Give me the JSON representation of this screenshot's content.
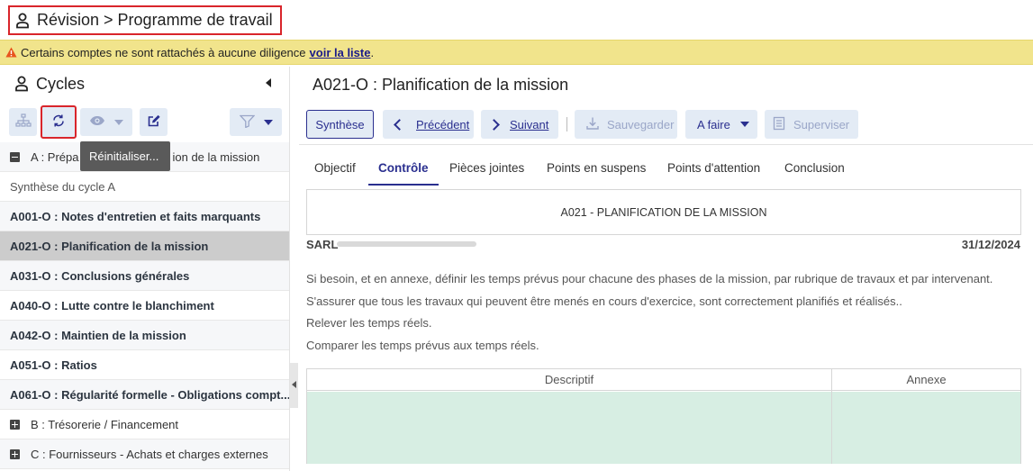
{
  "header": {
    "breadcrumb": "Révision > Programme de travail"
  },
  "warning": {
    "text": "Certains comptes ne sont rattachés à aucune diligence",
    "link": "voir la liste"
  },
  "left_panel": {
    "title": "Cycles",
    "tooltip": "Réinitialiser...",
    "tree": [
      {
        "label": "A : Prépa",
        "label_tail": "ion de la mission",
        "kind": "section",
        "expanded": true
      },
      {
        "label": "Synthèse du cycle A",
        "kind": "summary"
      },
      {
        "label": "A001-O : Notes d'entretien et faits marquants",
        "kind": "item"
      },
      {
        "label": "A021-O : Planification de la mission",
        "kind": "item",
        "selected": true
      },
      {
        "label": "A031-O : Conclusions générales",
        "kind": "item"
      },
      {
        "label": "A040-O : Lutte contre le blanchiment",
        "kind": "item"
      },
      {
        "label": "A042-O : Maintien de la mission",
        "kind": "item"
      },
      {
        "label": "A051-O : Ratios",
        "kind": "item"
      },
      {
        "label": "A061-O : Régularité formelle - Obligations compt...",
        "kind": "item"
      },
      {
        "label": "B : Trésorerie / Financement",
        "kind": "section",
        "expanded": false
      },
      {
        "label": "C : Fournisseurs - Achats et charges externes",
        "kind": "section",
        "expanded": false
      }
    ]
  },
  "main": {
    "title": "A021-O : Planification de la mission",
    "toolbar": {
      "synthese": "Synthèse",
      "precedent": "Précédent",
      "suivant": "Suivant",
      "sauvegarder": "Sauvegarder",
      "status": "A faire",
      "superviser": "Superviser"
    },
    "tabs": [
      "Objectif",
      "Contrôle",
      "Pièces jointes",
      "Points en suspens",
      "Points d'attention",
      "Conclusion"
    ],
    "active_tab": "Contrôle",
    "document": {
      "heading": "A021 - PLANIFICATION DE LA MISSION",
      "company": "SARL",
      "date": "31/12/2024",
      "instructions": [
        "Si besoin, et en annexe, définir les temps prévus pour chacune des phases de la mission, par rubrique de travaux et par intervenant.",
        "S'assurer que tous les travaux qui peuvent être menés en cours d'exercice, sont correctement planifiés et réalisés..",
        "Relever les temps réels.",
        "Comparer les temps prévus aux temps réels."
      ],
      "grid_headers": [
        "Descriptif",
        "Annexe"
      ]
    }
  },
  "colors": {
    "accent": "#2a2f8f",
    "highlight_border": "#d9252b",
    "warning_bg": "#f1e48c",
    "button_bg": "#e3ebf5",
    "selected_row": "#cccccc",
    "grid_cell": "#d7eee3"
  }
}
